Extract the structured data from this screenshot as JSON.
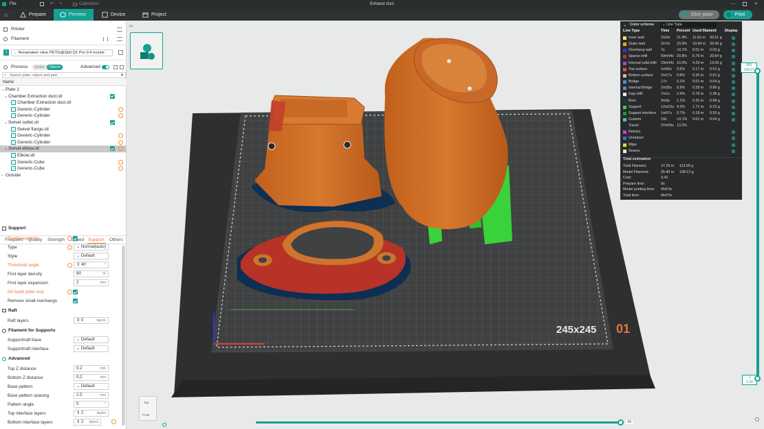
{
  "titlebar": {
    "file": "File",
    "document_title": "Exhaust duct",
    "calibration": "Calibration"
  },
  "tabs": [
    {
      "label": "Prepare"
    },
    {
      "label": "Preview"
    },
    {
      "label": "Device"
    },
    {
      "label": "Project"
    }
  ],
  "actions": {
    "slice": "Slice plate",
    "print": "Print"
  },
  "sidebar": {
    "printer": "Printer",
    "filament": "Filament",
    "filament_index": "1",
    "filament_name": "Novamaker clear PETG@Qidi Q1 Pro 0.4 nozzle",
    "process": "Process",
    "toggle_global": "Global",
    "toggle_objects": "Objects",
    "advanced": "Advanced",
    "search_placeholder": "Search plate, object and part.",
    "name_header": "Name",
    "tree": [
      {
        "label": "Plate 1"
      },
      {
        "label": "Chamber Extraction duct.stl"
      },
      {
        "label": "Chamber Extraction duct.stl"
      },
      {
        "label": "Generic-Cylinder"
      },
      {
        "label": "Generic-Cylinder"
      },
      {
        "label": "Swivel outlet.stl"
      },
      {
        "label": "Swivel flange.stl"
      },
      {
        "label": "Generic-Cylinder"
      },
      {
        "label": "Generic-Cylinder"
      },
      {
        "label": "Swivel elbow.stl"
      },
      {
        "label": "Elbow.stl"
      },
      {
        "label": "Generic-Cube"
      },
      {
        "label": "Generic-Cube"
      },
      {
        "label": "Outside"
      }
    ]
  },
  "settings_tabs": [
    "Frequent",
    "Quality",
    "Strength",
    "Speed",
    "Support",
    "Others"
  ],
  "settings": {
    "support_title": "Support",
    "enable_support": "Enable support",
    "type": "Type",
    "type_value": "Normal(auto)",
    "style": "Style",
    "style_value": "Default",
    "threshold_angle": "Threshold angle",
    "threshold_value": "40",
    "threshold_unit": "°",
    "first_layer_density": "First layer density",
    "density_value": "90",
    "density_unit": "%",
    "first_layer_expansion": "First layer expansion",
    "expansion_value": "2",
    "expansion_unit": "mm",
    "on_build_plate_only": "On build plate only",
    "remove_small_overhangs": "Remove small overhangs",
    "raft_title": "Raft",
    "raft_layers": "Raft layers",
    "raft_layers_value": "0",
    "raft_layers_unit": "layers",
    "filament_supports_title": "Filament for Supports",
    "support_raft_base": "Support/raft base",
    "support_raft_base_value": "Default",
    "support_raft_interface": "Support/raft interface",
    "support_raft_interface_value": "Default",
    "advanced_title": "Advanced",
    "top_z": "Top Z distance",
    "top_z_value": "0.2",
    "top_z_unit": "mm",
    "bottom_z": "Bottom Z distance",
    "bottom_z_value": "0.2",
    "bottom_z_unit": "mm",
    "base_pattern": "Base pattern",
    "base_pattern_value": "Default",
    "base_pattern_spacing": "Base pattern spacing",
    "base_pattern_spacing_value": "2.5",
    "base_pattern_spacing_unit": "mm",
    "pattern_angle": "Pattern angle",
    "pattern_angle_value": "0",
    "pattern_angle_unit": "°",
    "top_interface_layers": "Top interface layers",
    "top_interface_layers_value": "2",
    "top_interface_layers_unit": "layers",
    "bottom_interface_layers": "Bottom interface layers",
    "bottom_interface_layers_value": "2",
    "bottom_interface_layers_unit": "layers"
  },
  "legend": {
    "title": "Color scheme",
    "scheme": "Line Type",
    "headers": [
      "Line Type",
      "Time",
      "Percent",
      "Used filament",
      "Display"
    ],
    "rows": [
      {
        "name": "Inner wall",
        "time": "1h2m",
        "percent": "21.4%",
        "len": "11.62 m",
        "weight": "35.51 g",
        "color": "#f2e07a"
      },
      {
        "name": "Outer wall",
        "time": "1h7m",
        "percent": "23.3%",
        "len": "10.94 m",
        "weight": "33.43 g",
        "color": "#f0a31f"
      },
      {
        "name": "Overhang wall",
        "time": "7s",
        "percent": "<0.1%",
        "len": "0.01 m",
        "weight": "0.03 g",
        "color": "#2b38d6"
      },
      {
        "name": "Sparse infill",
        "time": "59m44s",
        "percent": "20.8%",
        "len": "6.76 m",
        "weight": "20.64 g",
        "color": "#b53737"
      },
      {
        "name": "Internal solid infill",
        "time": "29m34s",
        "percent": "10.3%",
        "len": "4.29 m",
        "weight": "13.09 g",
        "color": "#9b4bc4"
      },
      {
        "name": "Top surface",
        "time": "1m50s",
        "percent": "0.6%",
        "len": "0.17 m",
        "weight": "0.51 g",
        "color": "#e04a4a"
      },
      {
        "name": "Bottom surface",
        "time": "2m17s",
        "percent": "0.8%",
        "len": "0.20 m",
        "weight": "0.61 g",
        "color": "#c9c1a3"
      },
      {
        "name": "Bridge",
        "time": "17s",
        "percent": "0.1%",
        "len": "0.01 m",
        "weight": "0.04 g",
        "color": "#4f8fcf"
      },
      {
        "name": "Internal Bridge",
        "time": "2m35s",
        "percent": "0.9%",
        "len": "0.28 m",
        "weight": "0.86 g",
        "color": "#5d88b8"
      },
      {
        "name": "Gap infill",
        "time": "7m1s",
        "percent": "2.4%",
        "len": "0.78 m",
        "weight": "2.38 g",
        "color": "#e8e8e8"
      },
      {
        "name": "Brim",
        "time": "3m3s",
        "percent": "1.1%",
        "len": "0.32 m",
        "weight": "0.98 g",
        "color": "#0d3a5c"
      },
      {
        "name": "Support",
        "time": "12m15s",
        "percent": "4.3%",
        "len": "1.71 m",
        "weight": "5.23 g",
        "color": "#3bd03b"
      },
      {
        "name": "Support interface",
        "time": "1m57s",
        "percent": "0.7%",
        "len": "0.18 m",
        "weight": "0.55 g",
        "color": "#1f9b3a"
      },
      {
        "name": "Custom",
        "time": "10s",
        "percent": "<0.1%",
        "len": "0.01 m",
        "weight": "0.04 g",
        "color": "#4fc0b0"
      },
      {
        "name": "Travel",
        "time": "37m59s",
        "percent": "13.2%",
        "len": "",
        "weight": "",
        "color": ""
      },
      {
        "name": "Retract",
        "time": "",
        "percent": "",
        "len": "",
        "weight": "",
        "color": "#d23ad2"
      },
      {
        "name": "Unretract",
        "time": "",
        "percent": "",
        "len": "",
        "weight": "",
        "color": "#3a6ad2"
      },
      {
        "name": "Wipe",
        "time": "",
        "percent": "",
        "len": "",
        "weight": "",
        "color": "#e6d81f"
      },
      {
        "name": "Seams",
        "time": "",
        "percent": "",
        "len": "",
        "weight": "",
        "color": "#e8e8e8"
      }
    ],
    "total_title": "Total estimation",
    "totals": [
      {
        "label": "Total Filament:",
        "v1": "37.29 m",
        "v2": "113.90 g"
      },
      {
        "label": "Model Filament:",
        "v1": "35.40 m",
        "v2": "108.12 g"
      },
      {
        "label": "Cost:",
        "v1": "3.42",
        "v2": ""
      },
      {
        "label": "Prepare time:",
        "v1": "9s",
        "v2": ""
      },
      {
        "label": "Model printing time:",
        "v1": "4h47m",
        "v2": ""
      },
      {
        "label": "Total time:",
        "v1": "4h47m",
        "v2": ""
      }
    ]
  },
  "plate": {
    "size_label": "245x245",
    "plate_number": "01"
  },
  "layer_slider": {
    "top_layer": "683",
    "top_height": "135.67",
    "bottom_layer": "1",
    "bottom_height": "0.20"
  },
  "move_slider": {
    "value": "16"
  },
  "view_cube": {
    "top": "Top",
    "front": "Front"
  },
  "colors": {
    "accent": "#15a093",
    "orange": "#e8743b"
  }
}
